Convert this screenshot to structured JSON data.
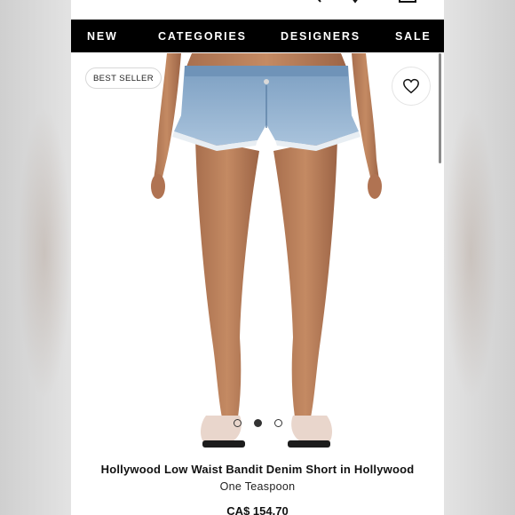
{
  "nav": {
    "items": [
      "NEW",
      "CATEGORIES",
      "DESIGNERS",
      "SALE"
    ]
  },
  "icons": {
    "header": [
      "search-icon",
      "heart-icon",
      "shopping-bag-icon"
    ],
    "wishlist": "heart-icon"
  },
  "product": {
    "badge": "BEST SELLER",
    "title": "Hollywood Low Waist Bandit Denim Short in Hollywood",
    "brand": "One Teaspoon",
    "price": "CA$ 154.70",
    "image_count": 3,
    "active_image": 1
  },
  "colors": {
    "nav_background": "#000000",
    "nav_text": "#ffffff",
    "denim": "#8fb0cf"
  }
}
